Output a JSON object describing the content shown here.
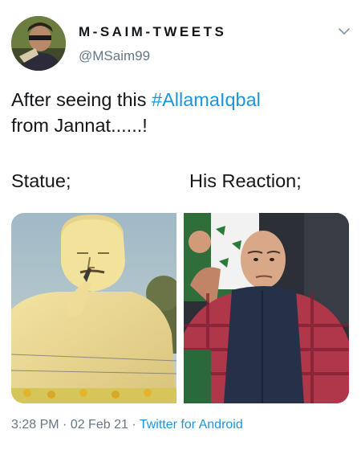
{
  "author": {
    "name": "M-SAIM-TWEETS",
    "handle": "@MSaim99",
    "avatar_icon": "profile-photo"
  },
  "menu_icon": "chevron-down-icon",
  "tweet": {
    "text_before": "After seeing this ",
    "hashtag": "#AllamaIqbal",
    "text_after": "from Jannat......!"
  },
  "captions": {
    "left": "Statue;",
    "right": "His Reaction;"
  },
  "media": [
    {
      "description_icon": "statue-photo"
    },
    {
      "description_icon": "reaction-photo"
    }
  ],
  "meta": {
    "time": "3:28 PM",
    "separator": " · ",
    "date": "02 Feb 21",
    "source": "Twitter for Android"
  },
  "colors": {
    "link": "#1b95e0",
    "secondary_text": "#657786",
    "primary_text": "#14171a"
  }
}
